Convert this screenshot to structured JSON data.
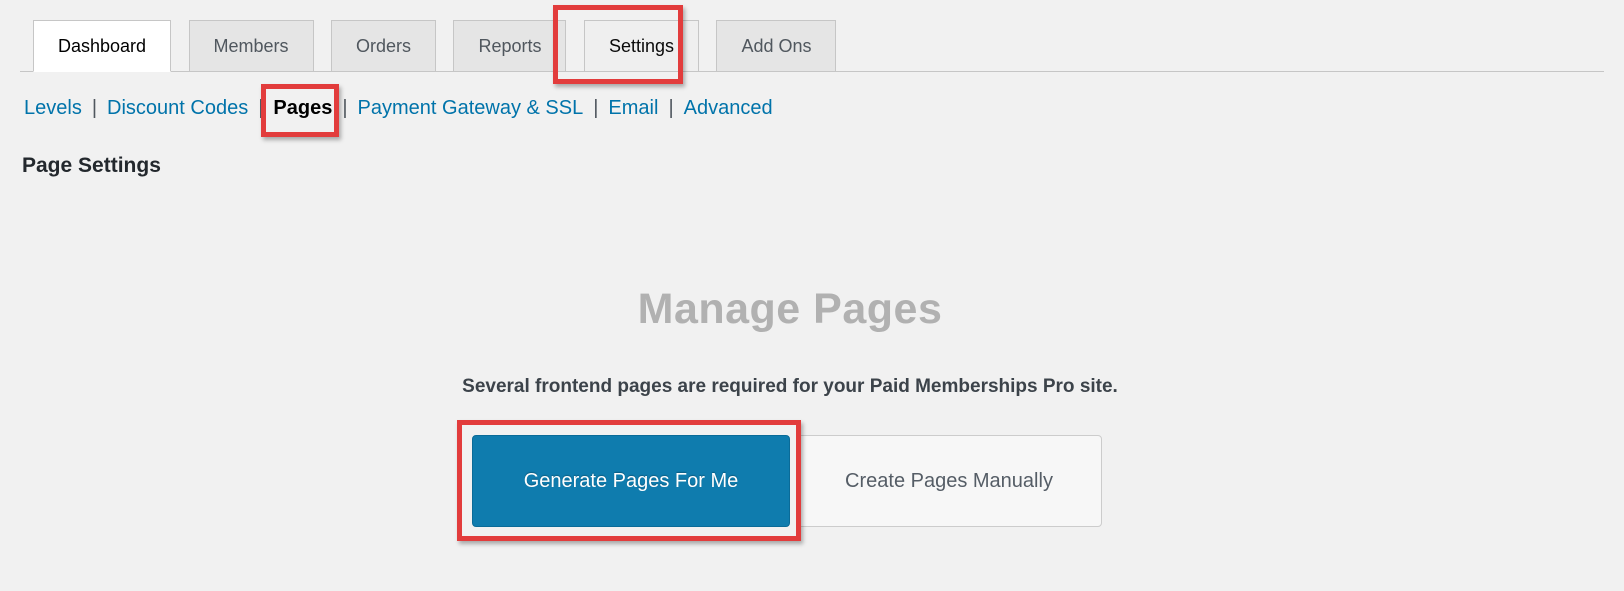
{
  "tabs": {
    "items": [
      {
        "label": "Dashboard",
        "state": "active"
      },
      {
        "label": "Members",
        "state": "normal"
      },
      {
        "label": "Orders",
        "state": "normal"
      },
      {
        "label": "Reports",
        "state": "normal"
      },
      {
        "label": "Settings",
        "state": "highlighted"
      },
      {
        "label": "Add Ons",
        "state": "normal"
      }
    ]
  },
  "subnav": {
    "separator": "|",
    "items": [
      {
        "label": "Levels"
      },
      {
        "label": "Discount Codes"
      },
      {
        "label": "Pages",
        "current": true
      },
      {
        "label": "Payment Gateway & SSL"
      },
      {
        "label": "Email"
      },
      {
        "label": "Advanced"
      }
    ]
  },
  "page": {
    "title": "Page Settings"
  },
  "main": {
    "heading": "Manage Pages",
    "description": "Several frontend pages are required for your Paid Memberships Pro site.",
    "primary_button": "Generate Pages For Me",
    "secondary_button": "Create Pages Manually"
  },
  "annotations": {
    "color": "#e23c3c",
    "highlighted_elements": [
      "Settings tab",
      "Pages subnav link",
      "Generate Pages For Me button"
    ]
  },
  "colors": {
    "background": "#f1f1f1",
    "link_blue": "#0073aa",
    "primary_button_blue": "#0f7cae",
    "muted_heading_gray": "#b1b1b1"
  }
}
